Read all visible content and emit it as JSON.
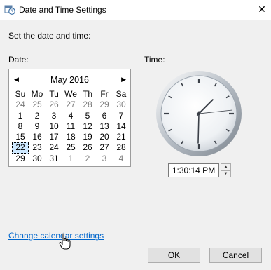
{
  "window": {
    "title": "Date and Time Settings",
    "close_glyph": "✕",
    "icon": "calendar-clock-icon"
  },
  "instruction": "Set the date and time:",
  "date_label": "Date:",
  "time_label": "Time:",
  "calendar": {
    "month_year": "May 2016",
    "prev_glyph": "◀",
    "next_glyph": "▶",
    "weekdays": [
      "Su",
      "Mo",
      "Tu",
      "We",
      "Th",
      "Fr",
      "Sa"
    ],
    "weeks": [
      [
        {
          "d": "24",
          "other": true
        },
        {
          "d": "25",
          "other": true
        },
        {
          "d": "26",
          "other": true
        },
        {
          "d": "27",
          "other": true
        },
        {
          "d": "28",
          "other": true
        },
        {
          "d": "29",
          "other": true
        },
        {
          "d": "30",
          "other": true
        }
      ],
      [
        {
          "d": "1"
        },
        {
          "d": "2"
        },
        {
          "d": "3"
        },
        {
          "d": "4"
        },
        {
          "d": "5"
        },
        {
          "d": "6"
        },
        {
          "d": "7"
        }
      ],
      [
        {
          "d": "8"
        },
        {
          "d": "9"
        },
        {
          "d": "10"
        },
        {
          "d": "11"
        },
        {
          "d": "12"
        },
        {
          "d": "13"
        },
        {
          "d": "14"
        }
      ],
      [
        {
          "d": "15"
        },
        {
          "d": "16"
        },
        {
          "d": "17"
        },
        {
          "d": "18"
        },
        {
          "d": "19"
        },
        {
          "d": "20"
        },
        {
          "d": "21"
        }
      ],
      [
        {
          "d": "22",
          "selected": true
        },
        {
          "d": "23"
        },
        {
          "d": "24"
        },
        {
          "d": "25"
        },
        {
          "d": "26"
        },
        {
          "d": "27"
        },
        {
          "d": "28"
        }
      ],
      [
        {
          "d": "29"
        },
        {
          "d": "30"
        },
        {
          "d": "31"
        },
        {
          "d": "1",
          "other": true
        },
        {
          "d": "2",
          "other": true
        },
        {
          "d": "3",
          "other": true
        },
        {
          "d": "4",
          "other": true
        }
      ]
    ]
  },
  "clock": {
    "hour": 1,
    "minute": 30,
    "second": 14
  },
  "time_value": "1:30:14 PM",
  "spinner": {
    "up_glyph": "▲",
    "down_glyph": "▼"
  },
  "link_text": "Change calendar settings",
  "buttons": {
    "ok": "OK",
    "cancel": "Cancel"
  },
  "colors": {
    "link": "#0066cc",
    "selected_day_bg": "#cde8ff",
    "dialog_bg": "#f0f0f0"
  }
}
